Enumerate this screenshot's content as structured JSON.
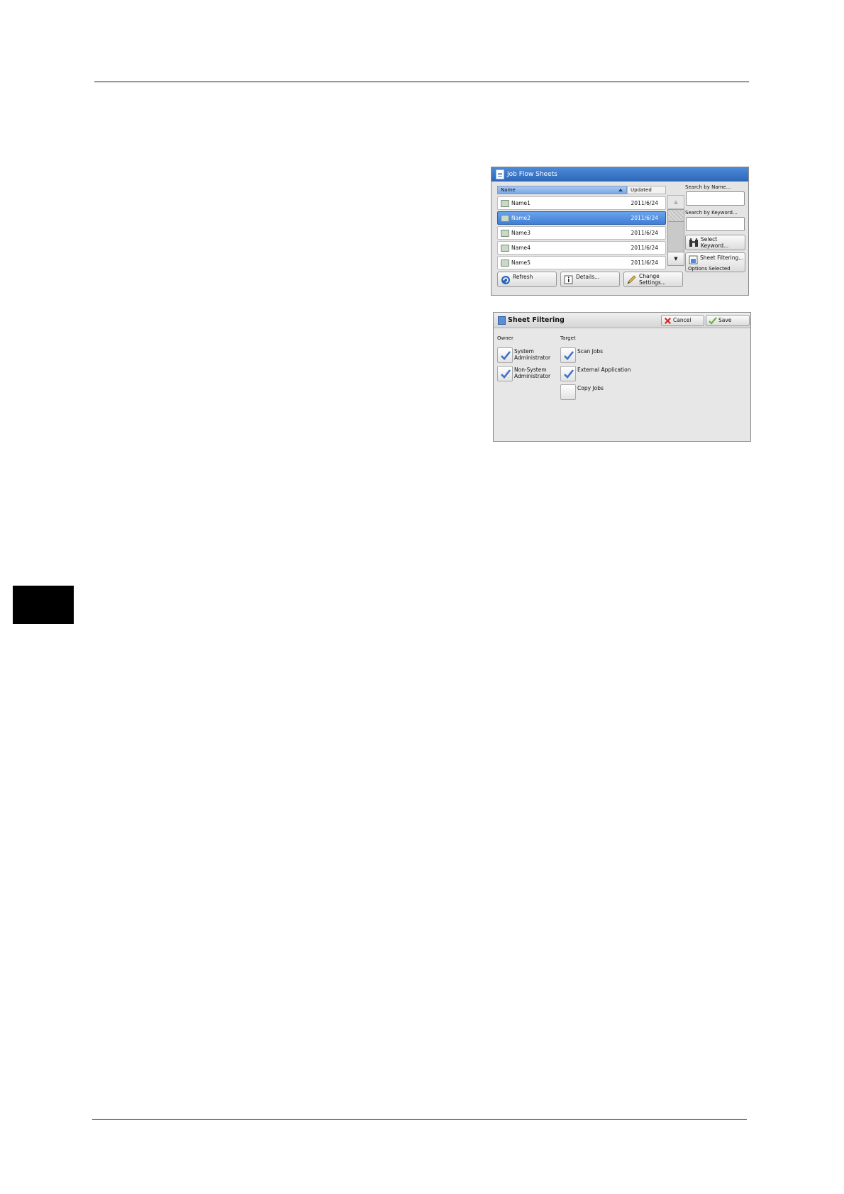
{
  "job_flow_sheets": {
    "title": "Job Flow Sheets",
    "columns": {
      "name": "Name",
      "updated": "Updated"
    },
    "rows": [
      {
        "name": "Name1",
        "updated": "2011/6/24"
      },
      {
        "name": "Name2",
        "updated": "2011/6/24",
        "selected": true
      },
      {
        "name": "Name3",
        "updated": "2011/6/24"
      },
      {
        "name": "Name4",
        "updated": "2011/6/24"
      },
      {
        "name": "Name5",
        "updated": "2011/6/24"
      }
    ],
    "search_by_name": {
      "label": "Search by Name...",
      "value": ""
    },
    "search_by_keyword": {
      "label": "Search by Keyword...",
      "value": ""
    },
    "select_keyword_button": {
      "line1": "Select",
      "line2": "Keyword..."
    },
    "sheet_filtering_button": {
      "label": "Sheet Filtering...",
      "status": "Options Selected"
    },
    "refresh_button": "Refresh",
    "details_button": "Details...",
    "change_settings_button": {
      "line1": "Change",
      "line2": "Settings..."
    }
  },
  "sheet_filtering": {
    "title": "Sheet Filtering",
    "cancel_button": "Cancel",
    "save_button": "Save",
    "owner": {
      "heading": "Owner",
      "options": [
        {
          "line1": "System",
          "line2": "Administrator",
          "checked": true
        },
        {
          "line1": "Non-System",
          "line2": "Administrator",
          "checked": true
        }
      ]
    },
    "target": {
      "heading": "Target",
      "options": [
        {
          "label": "Scan Jobs",
          "checked": true
        },
        {
          "label": "External Application",
          "checked": true
        },
        {
          "label": "Copy Jobs",
          "checked": false
        }
      ]
    }
  },
  "colors": {
    "title_blue": "#2d66b8",
    "selection_blue": "#3f7fd6",
    "check_blue": "#3d73c9",
    "cancel_red": "#d0261e",
    "save_green": "#6cb33f"
  }
}
